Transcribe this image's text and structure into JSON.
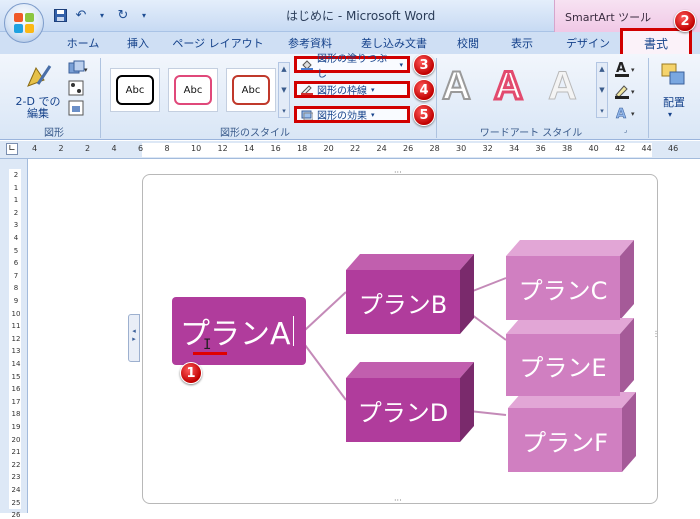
{
  "window": {
    "title": "はじめに - Microsoft Word",
    "context_tab_title": "SmartArt ツール"
  },
  "tabs": [
    "ホーム",
    "挿入",
    "ページ レイアウト",
    "参考資料",
    "差し込み文書",
    "校閲",
    "表示",
    "デザイン",
    "書式"
  ],
  "ribbon": {
    "group_shapes": {
      "edit_2d": "2-D での",
      "edit_2d_line2": "編集",
      "label": "図形"
    },
    "group_shape_styles": {
      "label": "図形のスタイル",
      "thumb_text": "Abc",
      "fill": "図形の塗りつぶし",
      "outline": "図形の枠線",
      "effects": "図形の効果"
    },
    "group_wordart": {
      "label": "ワードアート スタイル",
      "letter": "A"
    },
    "arrange": "配置"
  },
  "badges": [
    "1",
    "2",
    "3",
    "4",
    "5"
  ],
  "ruler_h": [
    "4",
    "2",
    "2",
    "4",
    "6",
    "8",
    "10",
    "12",
    "14",
    "16",
    "18",
    "20",
    "22",
    "24",
    "26",
    "28",
    "30",
    "32",
    "34",
    "36",
    "38",
    "40",
    "42",
    "44",
    "46"
  ],
  "ruler_v": [
    "2",
    "1",
    "1",
    "2",
    "3",
    "4",
    "5",
    "6",
    "7",
    "8",
    "9",
    "10",
    "11",
    "12",
    "13",
    "14",
    "15",
    "16",
    "17",
    "18",
    "19",
    "20",
    "21",
    "22",
    "23",
    "24",
    "25",
    "26"
  ],
  "diagram": {
    "nodes": {
      "a": "プランA",
      "b": "プランB",
      "c": "プランC",
      "d": "プランD",
      "e": "プランE",
      "f": "プランF"
    }
  },
  "colors": {
    "accent_red": "#d10000",
    "node_main": "#b03c9c",
    "node_light": "#d07fc1"
  }
}
